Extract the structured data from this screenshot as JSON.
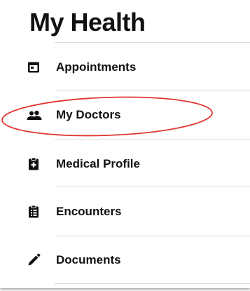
{
  "header": {
    "title": "My Health"
  },
  "nav": {
    "items": [
      {
        "label": "Appointments",
        "icon": "calendar-icon"
      },
      {
        "label": "My Doctors",
        "icon": "people-icon"
      },
      {
        "label": "Medical Profile",
        "icon": "clipboard-icon"
      },
      {
        "label": "Encounters",
        "icon": "clipboard-list-icon"
      },
      {
        "label": "Documents",
        "icon": "pencil-icon"
      }
    ]
  },
  "annotation": {
    "highlight_color": "#e0342f",
    "highlighted_item": "My Doctors"
  }
}
